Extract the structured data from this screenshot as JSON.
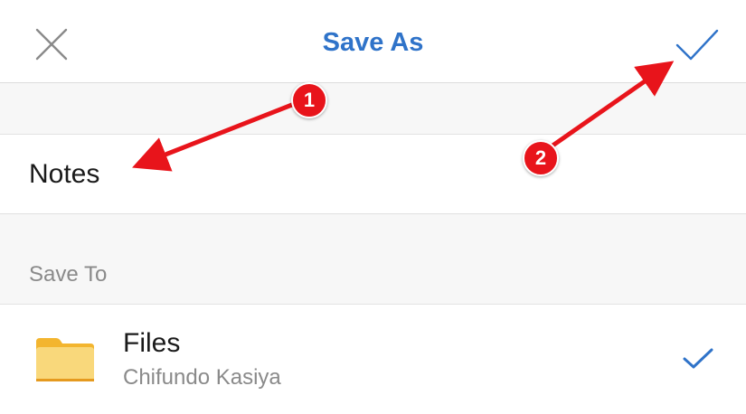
{
  "header": {
    "title": "Save As",
    "close_icon": "close-x-icon",
    "confirm_icon": "checkmark-icon",
    "accent_color": "#2f73c9"
  },
  "filename": {
    "value": "Notes"
  },
  "save_to": {
    "header": "Save To",
    "items": [
      {
        "name": "Files",
        "owner": "Chifundo Kasiya",
        "icon": "folder-icon",
        "selected": true
      }
    ]
  },
  "annotations": {
    "markers": [
      "1",
      "2"
    ],
    "color": "#e8141b"
  }
}
